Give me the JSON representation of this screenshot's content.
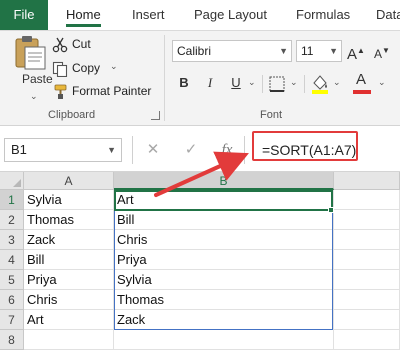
{
  "ribbon": {
    "tabs": [
      {
        "label": "File"
      },
      {
        "label": "Home"
      },
      {
        "label": "Insert"
      },
      {
        "label": "Page Layout"
      },
      {
        "label": "Formulas"
      },
      {
        "label": "Data"
      }
    ],
    "clipboard": {
      "paste_label": "Paste",
      "cut_label": "Cut",
      "copy_label": "Copy",
      "format_painter_label": "Format Painter",
      "group_label": "Clipboard"
    },
    "font": {
      "font_name": "Calibri",
      "font_size": "11",
      "bold": "B",
      "italic": "I",
      "underline": "U",
      "font_color_glyph": "A",
      "grow_glyph": "A",
      "shrink_glyph": "A",
      "group_label": "Font"
    }
  },
  "formula_bar": {
    "name_box": "B1",
    "cancel_glyph": "✕",
    "enter_glyph": "✓",
    "fx_label": "fx",
    "formula": "=SORT(A1:A7)"
  },
  "sheet": {
    "columns": [
      "A",
      "B"
    ],
    "rows": [
      "1",
      "2",
      "3",
      "4",
      "5",
      "6",
      "7",
      "8"
    ],
    "column_a": [
      "Sylvia",
      "Thomas",
      "Zack",
      "Bill",
      "Priya",
      "Chris",
      "Art",
      ""
    ],
    "column_b": [
      "Art",
      "Bill",
      "Chris",
      "Priya",
      "Sylvia",
      "Thomas",
      "Zack",
      ""
    ]
  },
  "colors": {
    "excel_green": "#217346",
    "highlight_red": "#e23b3b",
    "spill_blue": "#4472c4",
    "font_color_bar": "#e03030",
    "highlight_yellow": "#ffff00"
  }
}
